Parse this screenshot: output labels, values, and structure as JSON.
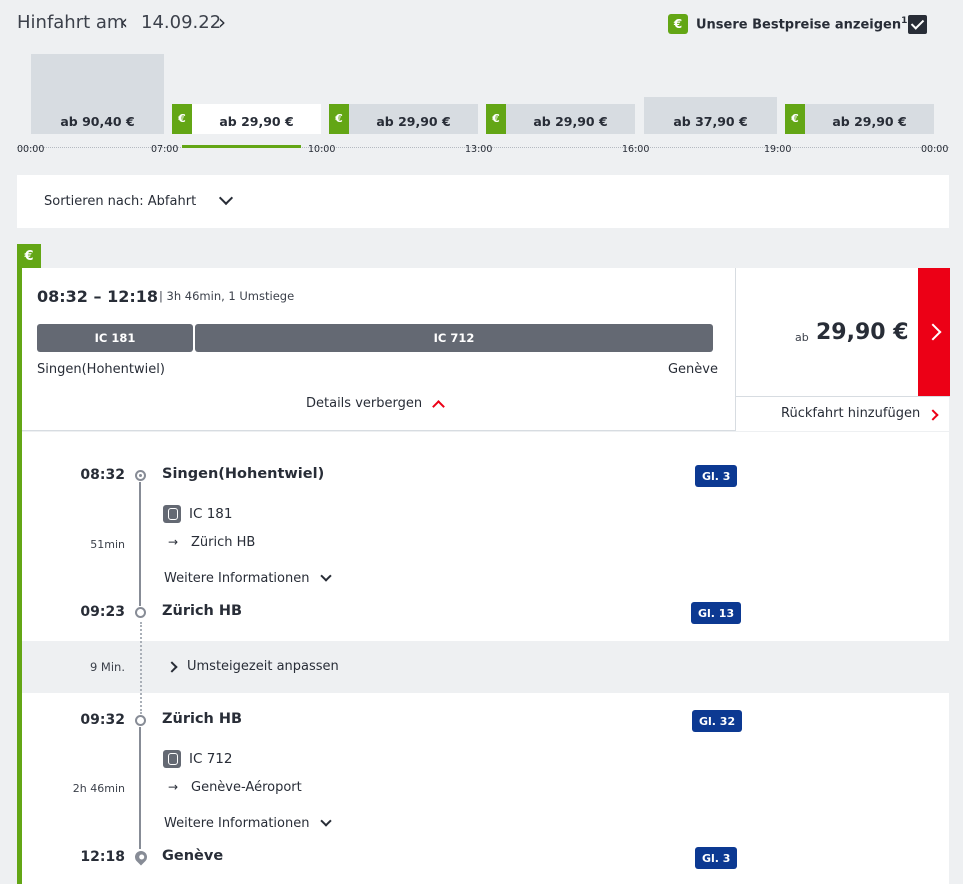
{
  "header": {
    "label": "Hinfahrt am",
    "date": "14.09.22",
    "prev_icon": "chevron-left-icon",
    "next_icon": "chevron-right-icon",
    "bestpreis_badge": "€",
    "bestpreis_label": "Unsere Bestpreise anzeigen",
    "bestpreis_sup": "1",
    "bestpreis_checked": true
  },
  "price_chart": {
    "bars": [
      {
        "label": "ab 90,40 €",
        "best": false,
        "selected": false,
        "slot": "00:00-07:00"
      },
      {
        "label": "ab 29,90 €",
        "best": true,
        "selected": true,
        "slot": "07:00-10:00"
      },
      {
        "label": "ab 29,90 €",
        "best": true,
        "selected": false,
        "slot": "10:00-13:00"
      },
      {
        "label": "ab 29,90 €",
        "best": true,
        "selected": false,
        "slot": "13:00-16:00"
      },
      {
        "label": "ab 37,90 €",
        "best": false,
        "selected": false,
        "slot": "16:00-19:00"
      },
      {
        "label": "ab 29,90 €",
        "best": true,
        "selected": false,
        "slot": "19:00-00:00"
      }
    ],
    "euro_symbol": "€",
    "ticks": [
      "00:00",
      "07:00",
      "10:00",
      "13:00",
      "16:00",
      "19:00",
      "00:00"
    ]
  },
  "sort": {
    "label": "Sortieren nach: Abfahrt"
  },
  "connection": {
    "euro_tag": "€",
    "times": "08:32 – 12:18",
    "duration": "| 3h 46min, 1 Umstiege",
    "trains": [
      "IC 181",
      "IC 712"
    ],
    "from": "Singen(Hohentwiel)",
    "to": "Genève",
    "details_toggle": "Details verbergen",
    "price_prefix": "ab",
    "price": "29,90 €",
    "return_label": "Rückfahrt hinzufügen"
  },
  "details": {
    "legs": [
      {
        "dep_time": "08:32",
        "dep_station": "Singen(Hohentwiel)",
        "dep_platform": "Gl. 3",
        "train": "IC 181",
        "direction": "Zürich HB",
        "duration": "51min",
        "more_info": "Weitere Informationen",
        "arr_time": "09:23",
        "arr_station": "Zürich HB",
        "arr_platform": "Gl. 13"
      },
      {
        "dep_time": "09:32",
        "dep_station": "Zürich HB",
        "dep_platform": "Gl. 32",
        "train": "IC 712",
        "direction": "Genève-Aéroport",
        "duration": "2h 46min",
        "more_info": "Weitere Informationen",
        "arr_time": "12:18",
        "arr_station": "Genève",
        "arr_platform": "Gl. 3"
      }
    ],
    "transfer": {
      "time": "9 Min.",
      "label": "Umsteigezeit anpassen"
    },
    "arrow": "→"
  },
  "colors": {
    "brand_red": "#ec0016",
    "best_green": "#63a615",
    "platform_blue": "#0c3992",
    "train_grey": "#646973"
  }
}
